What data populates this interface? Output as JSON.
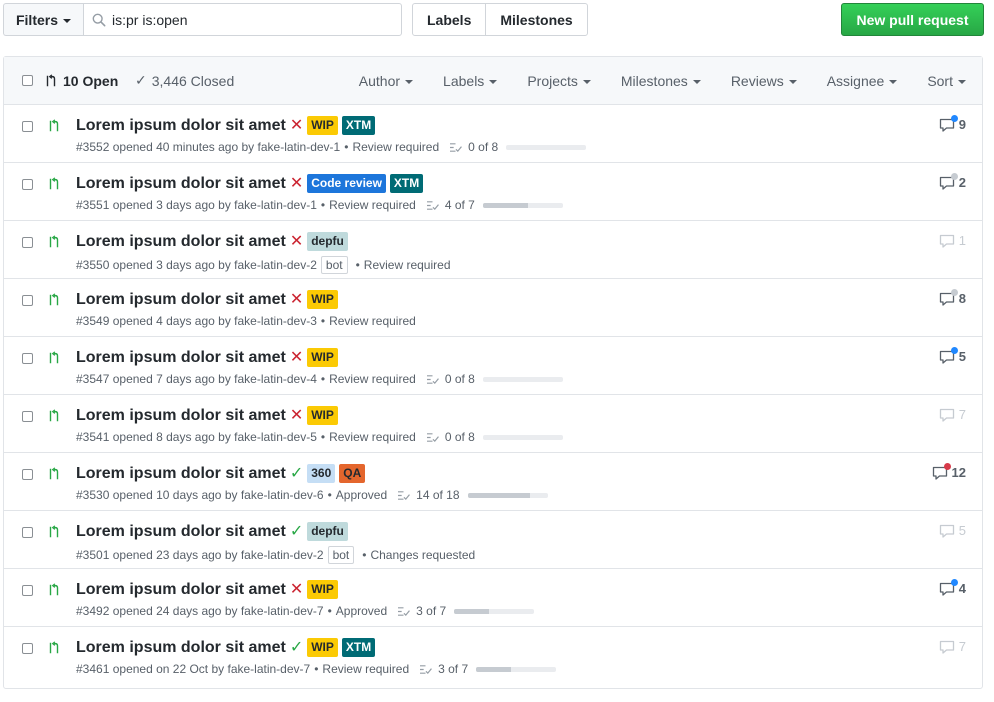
{
  "topbar": {
    "filters_label": "Filters",
    "search_value": "is:pr is:open",
    "labels_label": "Labels",
    "milestones_label": "Milestones",
    "new_pr_label": "New pull request"
  },
  "header": {
    "open_count": "10 Open",
    "closed_count": "3,446 Closed",
    "filters": [
      "Author",
      "Labels",
      "Projects",
      "Milestones",
      "Reviews",
      "Assignee",
      "Sort"
    ]
  },
  "colors": {
    "fail": "#cb2431",
    "success": "#28a745",
    "dot_blue": "#2188ff",
    "dot_gray": "#c6cbd1",
    "dot_red": "#d73a49"
  },
  "pulls": [
    {
      "title": "Lorem ipsum dolor sit amet",
      "status": "fail",
      "labels": [
        {
          "text": "WIP",
          "bg": "#fbca04",
          "fg": "#24292e"
        },
        {
          "text": "XTM",
          "bg": "#006b75",
          "fg": "#ffffff"
        }
      ],
      "number": "#3552",
      "opened": "opened 40 minutes ago by",
      "author": "fake-latin-dev-1",
      "bot": "",
      "review": "Review required",
      "tasks": "0 of 8",
      "progress": 0.0,
      "comments": "9",
      "dot": "blue"
    },
    {
      "title": "Lorem ipsum dolor sit amet",
      "status": "fail",
      "labels": [
        {
          "text": "Code review",
          "bg": "#1d76db",
          "fg": "#ffffff"
        },
        {
          "text": "XTM",
          "bg": "#006b75",
          "fg": "#ffffff"
        }
      ],
      "number": "#3551",
      "opened": "opened 3 days ago by",
      "author": "fake-latin-dev-1",
      "bot": "",
      "review": "Review required",
      "tasks": "4 of 7",
      "progress": 0.57,
      "comments": "2",
      "dot": "gray"
    },
    {
      "title": "Lorem ipsum dolor sit amet",
      "status": "fail",
      "labels": [
        {
          "text": "depfu",
          "bg": "#bfdadc",
          "fg": "#24292e"
        }
      ],
      "number": "#3550",
      "opened": "opened 3 days ago by",
      "author": "fake-latin-dev-2",
      "bot": "bot",
      "review": "Review required",
      "tasks": "",
      "progress": null,
      "comments": "1",
      "dot": ""
    },
    {
      "title": "Lorem ipsum dolor sit amet",
      "status": "fail",
      "labels": [
        {
          "text": "WIP",
          "bg": "#fbca04",
          "fg": "#24292e"
        }
      ],
      "number": "#3549",
      "opened": "opened 4 days ago by",
      "author": "fake-latin-dev-3",
      "bot": "",
      "review": "Review required",
      "tasks": "",
      "progress": null,
      "comments": "8",
      "dot": "gray"
    },
    {
      "title": "Lorem ipsum dolor sit amet",
      "status": "fail",
      "labels": [
        {
          "text": "WIP",
          "bg": "#fbca04",
          "fg": "#24292e"
        }
      ],
      "number": "#3547",
      "opened": "opened 7 days ago by",
      "author": "fake-latin-dev-4",
      "bot": "",
      "review": "Review required",
      "tasks": "0 of 8",
      "progress": 0.0,
      "comments": "5",
      "dot": "blue"
    },
    {
      "title": "Lorem ipsum dolor sit amet",
      "status": "fail",
      "labels": [
        {
          "text": "WIP",
          "bg": "#fbca04",
          "fg": "#24292e"
        }
      ],
      "number": "#3541",
      "opened": "opened 8 days ago by",
      "author": "fake-latin-dev-5",
      "bot": "",
      "review": "Review required",
      "tasks": "0 of 8",
      "progress": 0.0,
      "comments": "7",
      "dot": ""
    },
    {
      "title": "Lorem ipsum dolor sit amet",
      "status": "ok",
      "labels": [
        {
          "text": "360",
          "bg": "#c5def5",
          "fg": "#24292e"
        },
        {
          "text": "QA",
          "bg": "#e4662d",
          "fg": "#24292e"
        }
      ],
      "number": "#3530",
      "opened": "opened 10 days ago by",
      "author": "fake-latin-dev-6",
      "bot": "",
      "review": "Approved",
      "tasks": "14 of 18",
      "progress": 0.78,
      "comments": "12",
      "dot": "red"
    },
    {
      "title": "Lorem ipsum dolor sit amet",
      "status": "ok",
      "labels": [
        {
          "text": "depfu",
          "bg": "#bfdadc",
          "fg": "#24292e"
        }
      ],
      "number": "#3501",
      "opened": "opened 23 days ago by",
      "author": "fake-latin-dev-2",
      "bot": "bot",
      "review": "Changes requested",
      "tasks": "",
      "progress": null,
      "comments": "5",
      "dot": ""
    },
    {
      "title": "Lorem ipsum dolor sit amet",
      "status": "fail",
      "labels": [
        {
          "text": "WIP",
          "bg": "#fbca04",
          "fg": "#24292e"
        }
      ],
      "number": "#3492",
      "opened": "opened 24 days ago by",
      "author": "fake-latin-dev-7",
      "bot": "",
      "review": "Approved",
      "tasks": "3 of 7",
      "progress": 0.43,
      "comments": "4",
      "dot": "blue"
    },
    {
      "title": "Lorem ipsum dolor sit amet",
      "status": "ok",
      "labels": [
        {
          "text": "WIP",
          "bg": "#fbca04",
          "fg": "#24292e"
        },
        {
          "text": "XTM",
          "bg": "#006b75",
          "fg": "#ffffff"
        }
      ],
      "number": "#3461",
      "opened": "opened on 22 Oct by",
      "author": "fake-latin-dev-7",
      "bot": "",
      "review": "Review required",
      "tasks": "3 of 7",
      "progress": 0.43,
      "comments": "7",
      "dot": ""
    }
  ]
}
